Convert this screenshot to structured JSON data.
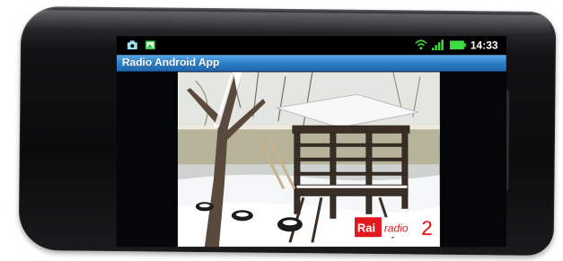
{
  "status_bar": {
    "icons": [
      "camera-icon",
      "image-icon",
      "wifi-icon",
      "signal-icon",
      "battery-icon"
    ],
    "time": "14:33"
  },
  "app": {
    "title": "Radio Android App"
  },
  "stream": {
    "logo_text_rai": "Rai",
    "logo_text_radio": "radio",
    "logo_text_channel": "2",
    "logo_color_red": "#e3181e",
    "logo_color_white": "#ffffff"
  },
  "colors": {
    "title_bar": "#2b7cc6",
    "status_bar": "#000000",
    "signal_green": "#3fdc3f"
  }
}
